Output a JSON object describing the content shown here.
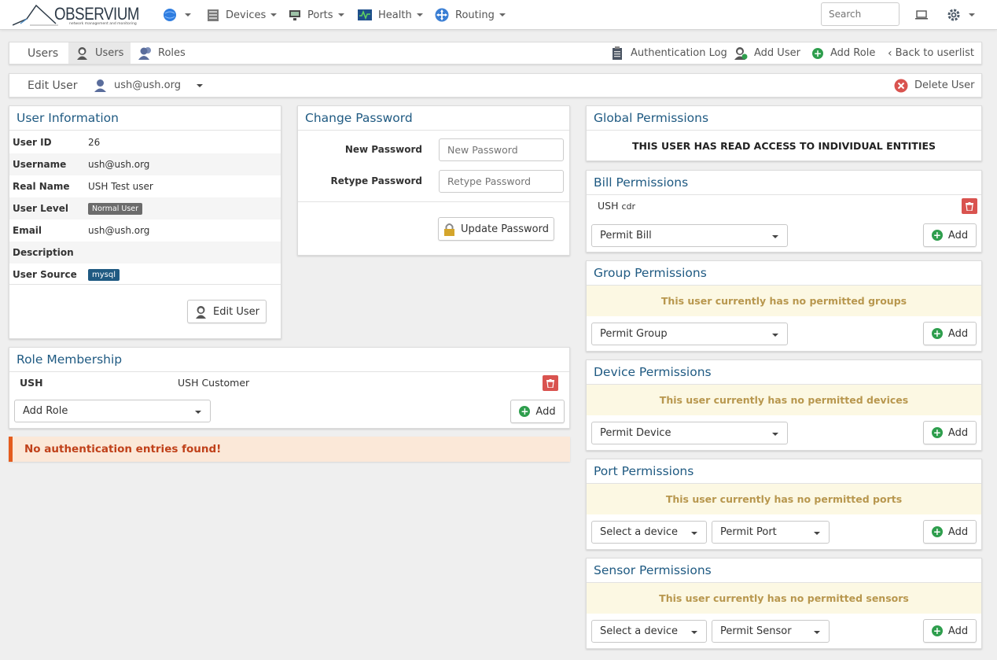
{
  "nav": {
    "logo": "OBSERVIUM",
    "logo_sub": "network management and monitoring",
    "devices": "Devices",
    "ports": "Ports",
    "health": "Health",
    "routing": "Routing",
    "search_placeholder": "Search"
  },
  "tabs": {
    "section": "Users",
    "users": "Users",
    "roles": "Roles",
    "auth_log": "Authentication Log",
    "add_user": "Add User",
    "add_role": "Add Role",
    "back": "Back to userlist"
  },
  "editbar": {
    "label": "Edit User",
    "user": "ush@ush.org",
    "delete": "Delete User"
  },
  "user_info": {
    "title": "User Information",
    "rows": [
      {
        "label": "User ID",
        "value": "26"
      },
      {
        "label": "Username",
        "value": "ush@ush.org"
      },
      {
        "label": "Real Name",
        "value": "USH Test user"
      },
      {
        "label": "User Level",
        "value": "Normal User"
      },
      {
        "label": "Email",
        "value": "ush@ush.org"
      },
      {
        "label": "Description",
        "value": ""
      },
      {
        "label": "User Source",
        "value": "mysql"
      }
    ],
    "edit_button": "Edit User",
    "level_color": "#6b6b6b",
    "source_color": "#1f5a82"
  },
  "password": {
    "title": "Change Password",
    "new_label": "New Password",
    "new_placeholder": "New Password",
    "retype_label": "Retype Password",
    "retype_placeholder": "Retype Password",
    "update_button": "Update Password"
  },
  "roles": {
    "title": "Role Membership",
    "entry_name": "USH",
    "entry_desc": "USH Customer",
    "add_select": "Add Role",
    "add_button": "Add"
  },
  "alert": "No authentication entries found!",
  "global": {
    "title": "Global Permissions",
    "message": "THIS USER HAS READ ACCESS TO INDIVIDUAL ENTITIES"
  },
  "bill": {
    "title": "Bill Permissions",
    "entry_name": "USH",
    "entry_extra": "cdr",
    "select": "Permit Bill",
    "add": "Add"
  },
  "group": {
    "title": "Group Permissions",
    "notice": "This user currently has no permitted groups",
    "select": "Permit Group",
    "add": "Add"
  },
  "device": {
    "title": "Device Permissions",
    "notice": "This user currently has no permitted devices",
    "select": "Permit Device",
    "add": "Add"
  },
  "port": {
    "title": "Port Permissions",
    "notice": "This user currently has no permitted ports",
    "device_select": "Select a device",
    "select": "Permit Port",
    "add": "Add"
  },
  "sensor": {
    "title": "Sensor Permissions",
    "notice": "This user currently has no permitted sensors",
    "device_select": "Select a device",
    "select": "Permit Sensor",
    "add": "Add"
  },
  "colors": {
    "title_blue": "#1f5a82",
    "add_green": "#2e9e4d",
    "delete_red": "#d9534f",
    "alert_orange": "#e45c1e"
  }
}
